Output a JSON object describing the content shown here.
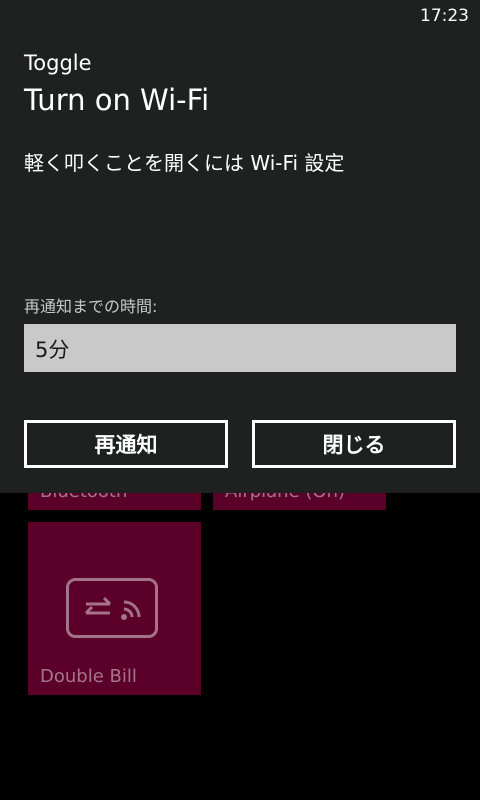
{
  "status_bar": {
    "time": "17:23"
  },
  "tiles": {
    "bluetooth": {
      "label": "Bluetooth"
    },
    "airplane": {
      "label": "Airplane (On)"
    },
    "double_bill": {
      "label": "Double Bill",
      "icon": "swap-wifi-icon"
    }
  },
  "reminder": {
    "app_name": "Toggle",
    "title": "Turn on Wi-Fi",
    "body": "軽く叩くことを開くには Wi-Fi 設定",
    "snooze_label": "再通知までの時間:",
    "snooze_value": "5分",
    "snooze_button": "再通知",
    "dismiss_button": "閉じる"
  },
  "colors": {
    "overlay_bg": "#1e2120",
    "tile_bg": "#5a0029",
    "select_bg": "#c9c9c9"
  }
}
